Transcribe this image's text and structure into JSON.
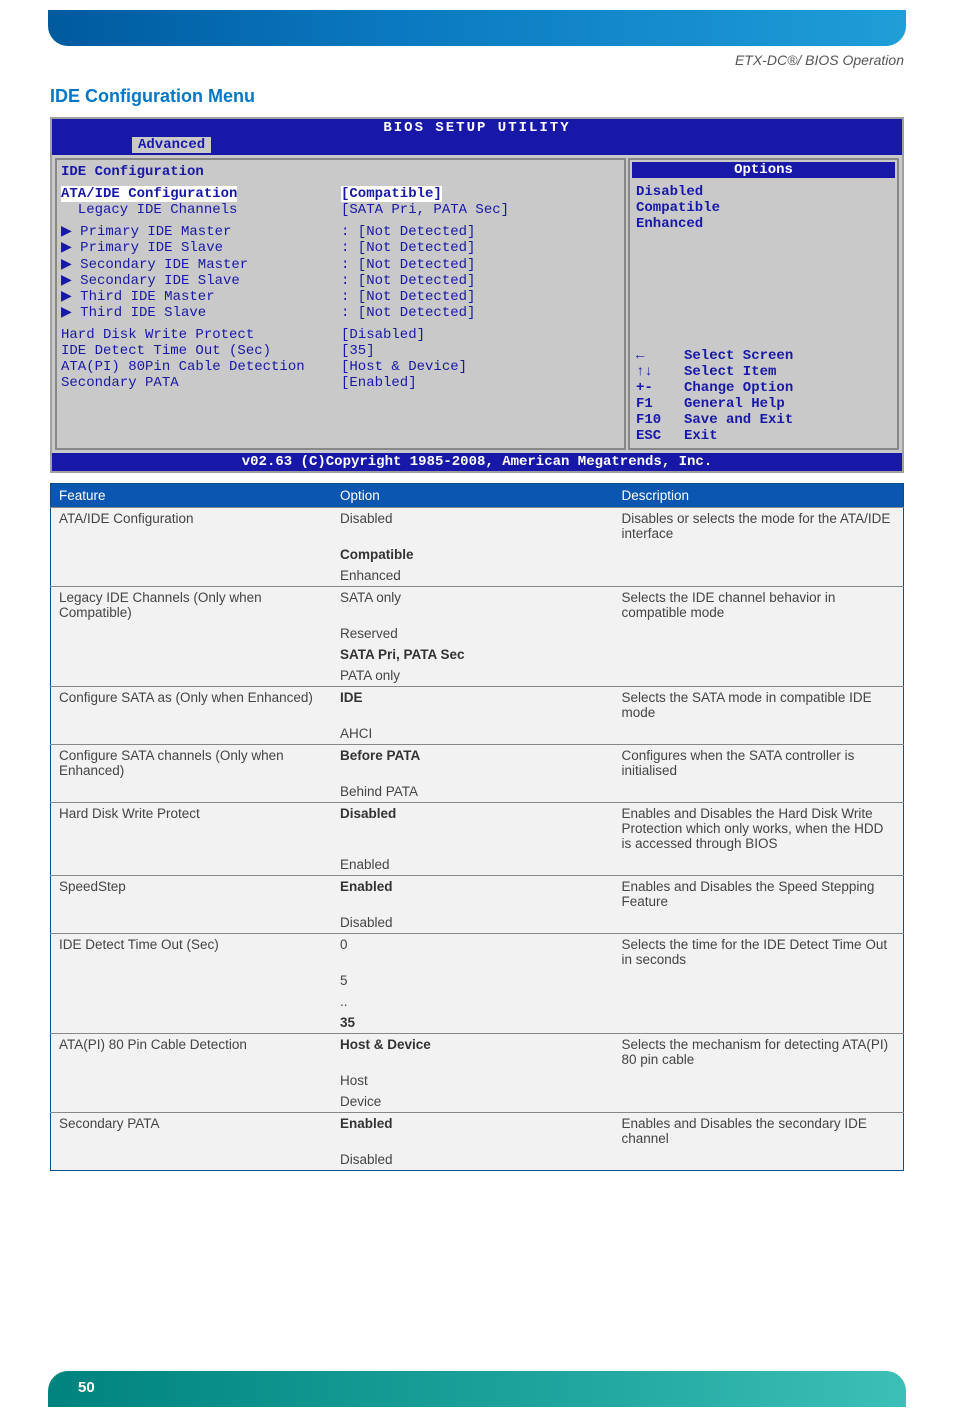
{
  "header": {
    "doc_path": "ETX-DC®/ BIOS Operation"
  },
  "section": {
    "title": "IDE Configuration Menu"
  },
  "bios": {
    "title": "BIOS SETUP UTILITY",
    "active_tab": "Advanced",
    "panel_title": "IDE Configuration",
    "rows_top": [
      {
        "label": "ATA/IDE Configuration",
        "value": "[Compatible]",
        "selected": true
      },
      {
        "label": "  Legacy IDE Channels",
        "value": "[SATA Pri, PATA Sec]"
      }
    ],
    "ide_list": [
      {
        "label": "Primary IDE Master",
        "value": "[Not Detected]"
      },
      {
        "label": "Primary IDE Slave",
        "value": "[Not Detected]"
      },
      {
        "label": "Secondary IDE Master",
        "value": "[Not Detected]"
      },
      {
        "label": "Secondary IDE Slave",
        "value": "[Not Detected]"
      },
      {
        "label": "Third IDE Master",
        "value": "[Not Detected]"
      },
      {
        "label": "Third IDE Slave",
        "value": "[Not Detected]"
      }
    ],
    "rows_bottom": [
      {
        "label": "Hard Disk Write Protect",
        "value": "[Disabled]"
      },
      {
        "label": "IDE Detect Time Out (Sec)",
        "value": "[35]"
      },
      {
        "label": "ATA(PI) 80Pin Cable Detection",
        "value": "[Host & Device]"
      },
      {
        "label": "Secondary PATA",
        "value": "[Enabled]"
      }
    ],
    "options_header": "Options",
    "options": [
      "Disabled",
      "Compatible",
      "Enhanced"
    ],
    "help": [
      {
        "key": "←",
        "text": "Select Screen"
      },
      {
        "key": "↑↓",
        "text": "Select Item"
      },
      {
        "key": "+-",
        "text": "Change Option"
      },
      {
        "key": "F1",
        "text": "General Help"
      },
      {
        "key": "F10",
        "text": "Save and Exit"
      },
      {
        "key": "ESC",
        "text": "Exit"
      }
    ],
    "footer": "v02.63 (C)Copyright 1985-2008, American Megatrends, Inc."
  },
  "table": {
    "headers": [
      "Feature",
      "Option",
      "Description"
    ],
    "rows": [
      {
        "feature": "ATA/IDE Configuration",
        "options": [
          {
            "text": "Disabled",
            "bold": false
          },
          {
            "text": "Compatible",
            "bold": true
          },
          {
            "text": "Enhanced",
            "bold": false
          }
        ],
        "description": "Disables or selects the mode for the ATA/IDE interface"
      },
      {
        "feature": "Legacy IDE Channels (Only when Compatible)",
        "options": [
          {
            "text": "SATA only",
            "bold": false
          },
          {
            "text": "Reserved",
            "bold": false
          },
          {
            "text": "SATA Pri, PATA Sec",
            "bold": true
          },
          {
            "text": "PATA only",
            "bold": false
          }
        ],
        "description": "Selects the IDE channel behavior in compatible mode"
      },
      {
        "feature": "Configure SATA as (Only when Enhanced)",
        "options": [
          {
            "text": "IDE",
            "bold": true
          },
          {
            "text": "AHCI",
            "bold": false
          }
        ],
        "description": "Selects the SATA mode in compatible IDE mode"
      },
      {
        "feature": "Configure SATA channels (Only when Enhanced)",
        "options": [
          {
            "text": "Before PATA",
            "bold": true
          },
          {
            "text": "Behind PATA",
            "bold": false
          }
        ],
        "description": "Configures when the SATA controller is initialised"
      },
      {
        "feature": "Hard Disk Write Protect",
        "options": [
          {
            "text": "Disabled",
            "bold": true
          },
          {
            "text": "Enabled",
            "bold": false
          }
        ],
        "description": "Enables and Disables the Hard Disk Write Protection which only works, when the HDD is accessed through BIOS"
      },
      {
        "feature": "SpeedStep",
        "options": [
          {
            "text": "Enabled",
            "bold": true
          },
          {
            "text": "Disabled",
            "bold": false
          }
        ],
        "description": "Enables and Disables the Speed Stepping Feature"
      },
      {
        "feature": "IDE Detect Time Out (Sec)",
        "options": [
          {
            "text": "0",
            "bold": false
          },
          {
            "text": "5",
            "bold": false
          },
          {
            "text": "..",
            "bold": false
          },
          {
            "text": "35",
            "bold": true
          }
        ],
        "description": "Selects the time for the IDE Detect Time Out in seconds"
      },
      {
        "feature": "ATA(PI) 80 Pin Cable Detection",
        "options": [
          {
            "text": "Host & Device",
            "bold": true
          },
          {
            "text": "Host",
            "bold": false
          },
          {
            "text": "Device",
            "bold": false
          }
        ],
        "description": "Selects the mechanism for detecting ATA(PI) 80 pin cable"
      },
      {
        "feature": "Secondary PATA",
        "options": [
          {
            "text": "Enabled",
            "bold": true
          },
          {
            "text": "Disabled",
            "bold": false
          }
        ],
        "description": "Enables and Disables the secondary IDE channel"
      }
    ]
  },
  "page": {
    "number": "50"
  }
}
